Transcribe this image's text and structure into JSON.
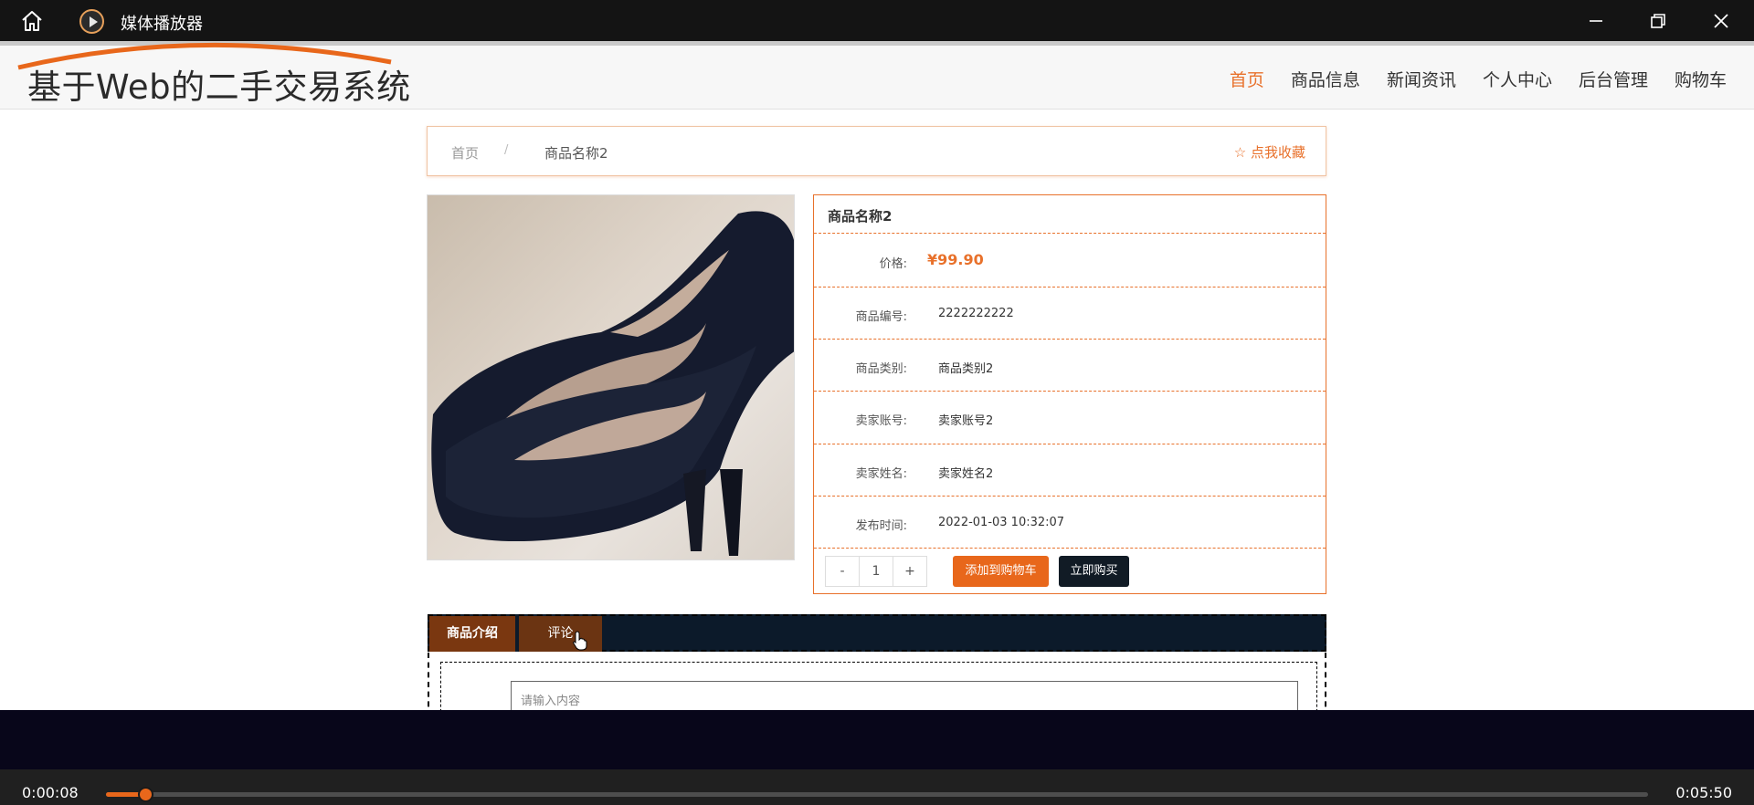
{
  "window": {
    "title": "媒体播放器",
    "icons": [
      "home-icon",
      "media-player-icon",
      "minimize-icon",
      "restore-icon",
      "close-icon"
    ]
  },
  "site": {
    "brand": "基于Web的二手交易系统",
    "nav": [
      "首页",
      "商品信息",
      "新闻资讯",
      "个人中心",
      "后台管理",
      "购物车"
    ],
    "active_nav": "首页"
  },
  "breadcrumb": {
    "home": "首页",
    "separator": "/",
    "current": "商品名称2",
    "favorite": "☆ 点我收藏"
  },
  "product": {
    "name": "商品名称2",
    "price_label": "价格:",
    "price": "¥99.90",
    "fields": [
      {
        "label": "商品编号:",
        "value": "2222222222"
      },
      {
        "label": "商品类别:",
        "value": "商品类别2"
      },
      {
        "label": "卖家账号:",
        "value": "卖家账号2"
      },
      {
        "label": "卖家姓名:",
        "value": "卖家姓名2"
      },
      {
        "label": "发布时间:",
        "value": "2022-01-03 10:32:07"
      }
    ],
    "quantity": {
      "minus": "-",
      "value": "1",
      "plus": "+"
    },
    "add_to_cart": "添加到购物车",
    "buy_now": "立即购买"
  },
  "tabs": [
    "商品介绍",
    "评论"
  ],
  "comment_placeholder": "请输入内容",
  "player": {
    "elapsed": "0:00:08",
    "duration": "0:05:50",
    "progress": 0.0257
  },
  "colors": {
    "accent": "#e8712b",
    "dark": "#111b25",
    "tab_bg": "#7a3710"
  }
}
